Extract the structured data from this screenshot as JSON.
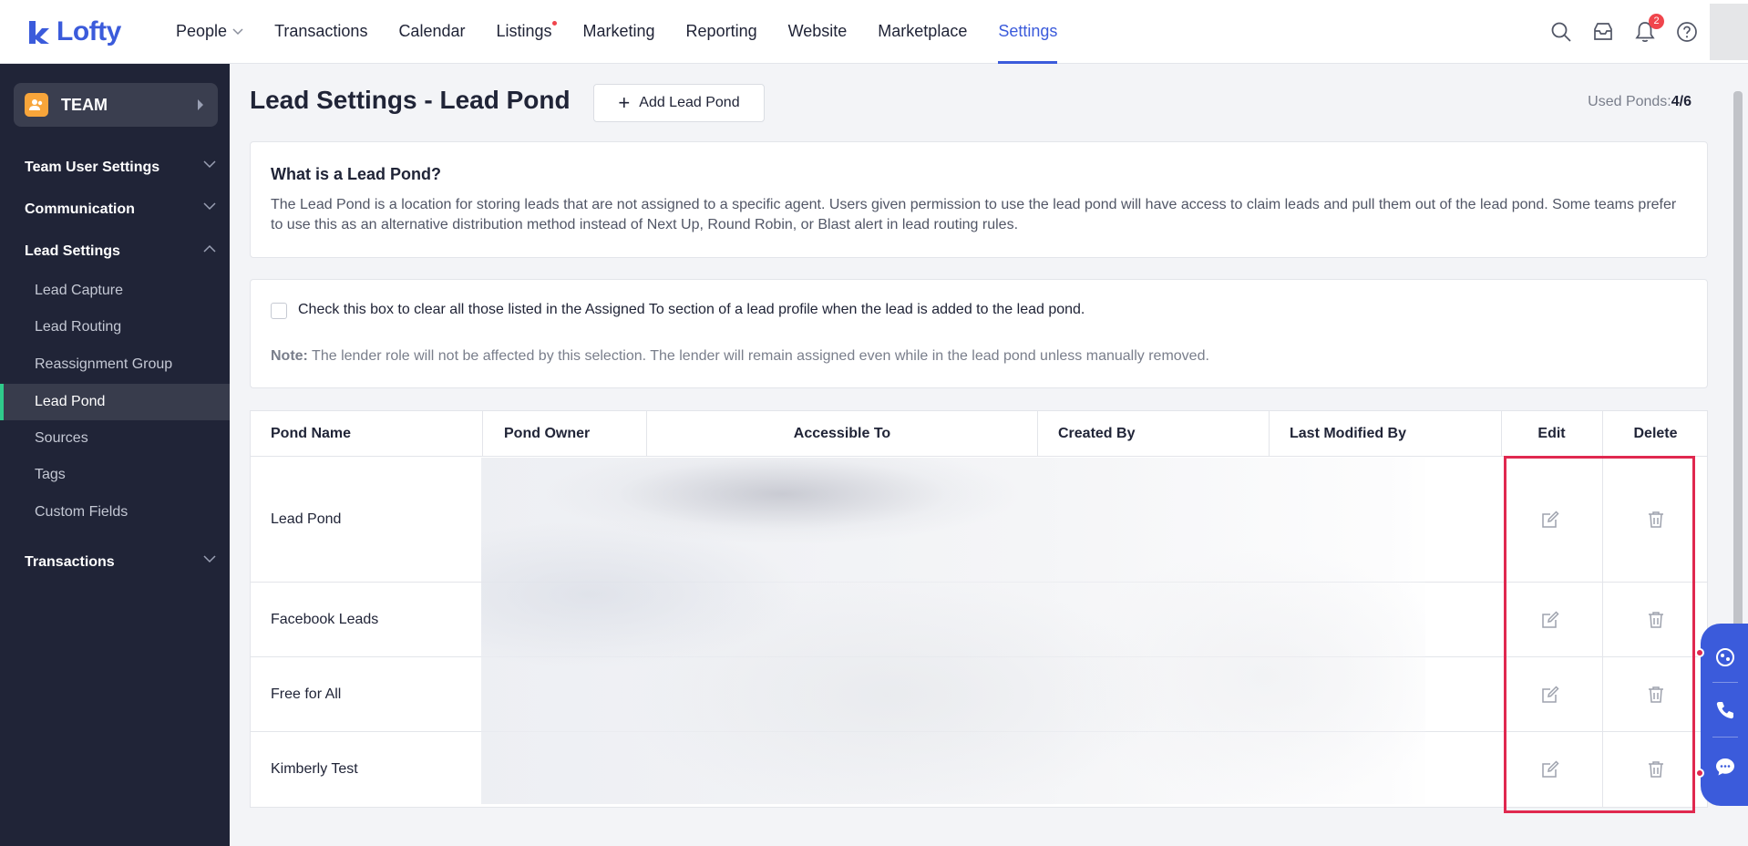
{
  "app": {
    "name": "Lofty"
  },
  "nav": {
    "items": [
      {
        "label": "People",
        "has_dropdown": true
      },
      {
        "label": "Transactions"
      },
      {
        "label": "Calendar"
      },
      {
        "label": "Listings",
        "has_dot": true
      },
      {
        "label": "Marketing"
      },
      {
        "label": "Reporting"
      },
      {
        "label": "Website"
      },
      {
        "label": "Marketplace"
      },
      {
        "label": "Settings",
        "active": true
      }
    ],
    "notification_count": "2"
  },
  "sidebar": {
    "team_label": "TEAM",
    "sections": [
      {
        "label": "Team User Settings",
        "expanded": false
      },
      {
        "label": "Communication",
        "expanded": false
      },
      {
        "label": "Lead Settings",
        "expanded": true
      },
      {
        "label": "Transactions",
        "expanded": false
      }
    ],
    "lead_settings_items": [
      {
        "label": "Lead Capture"
      },
      {
        "label": "Lead Routing"
      },
      {
        "label": "Reassignment Group"
      },
      {
        "label": "Lead Pond",
        "active": true
      },
      {
        "label": "Sources"
      },
      {
        "label": "Tags"
      },
      {
        "label": "Custom Fields"
      }
    ]
  },
  "page": {
    "title": "Lead Settings - Lead Pond",
    "add_button": "Add Lead Pond",
    "used_label": "Used Ponds:",
    "used_value": "4/6"
  },
  "info": {
    "title": "What is a Lead Pond?",
    "text": "The Lead Pond is a location for storing leads that are not assigned to a specific agent. Users given permission to use the lead pond will have access to claim leads and pull them out of the lead pond. Some teams prefer to use this as an alternative distribution method instead of Next Up, Round Robin, or Blast alert in lead routing rules."
  },
  "option": {
    "checkbox_label": "Check this box to clear all those listed in the Assigned To section of a lead profile when the lead is added to the lead pond.",
    "checked": false,
    "note_label": "Note:",
    "note_text": " The lender role will not be affected by this selection. The lender will remain assigned even while in the lead pond unless manually removed."
  },
  "table": {
    "columns": [
      "Pond Name",
      "Pond Owner",
      "Accessible To",
      "Created By",
      "Last Modified By",
      "Edit",
      "Delete"
    ],
    "rows": [
      {
        "name": "Lead Pond"
      },
      {
        "name": "Facebook Leads"
      },
      {
        "name": "Free for All"
      },
      {
        "name": "Kimberly Test"
      }
    ]
  },
  "colors": {
    "accent": "#3b5bdb",
    "sidebar_bg": "#202437",
    "active_marker": "#2fcb8b",
    "highlight": "#e0284f"
  }
}
